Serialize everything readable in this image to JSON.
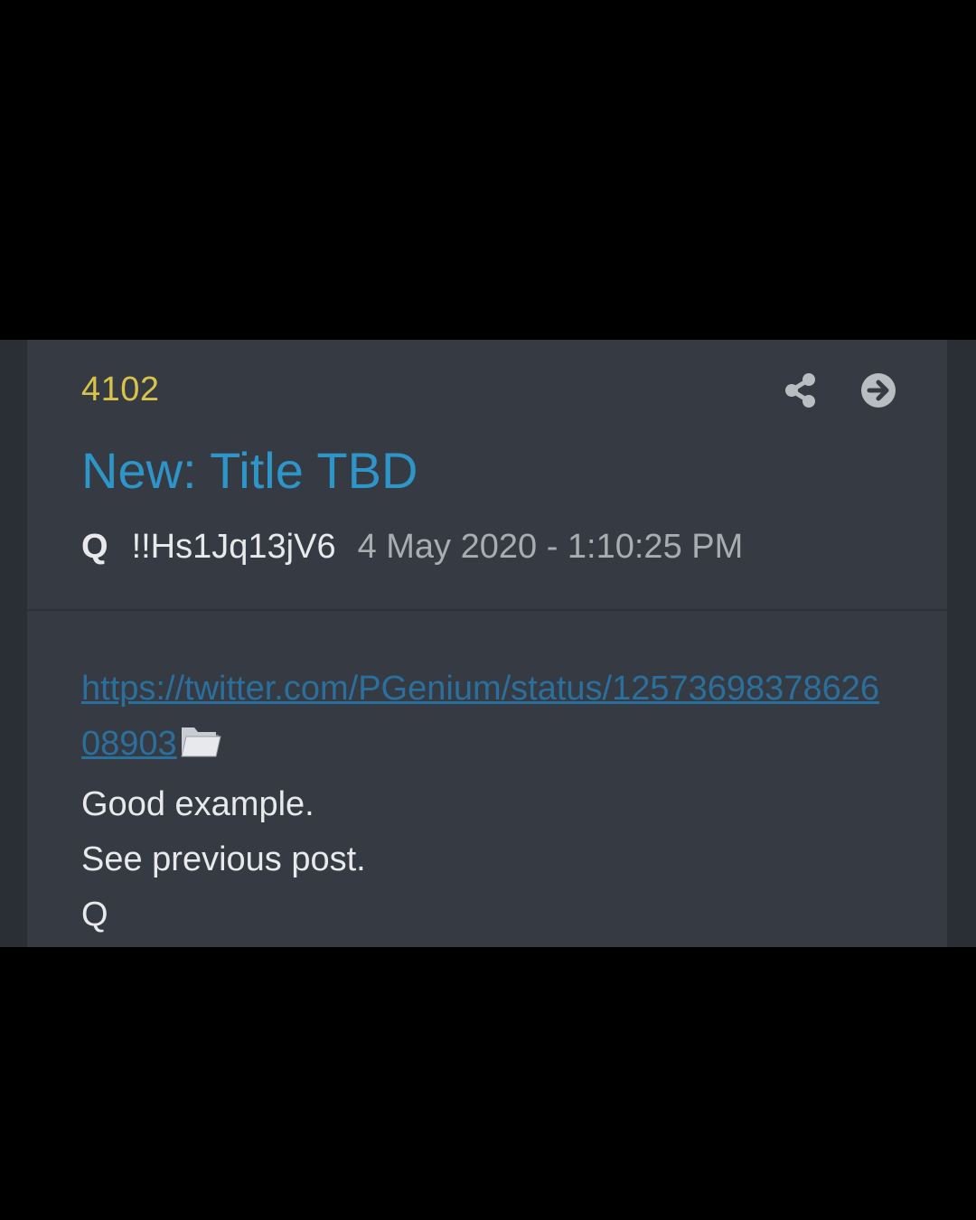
{
  "post": {
    "number": "4102",
    "title": "New: Title TBD",
    "author": "Q",
    "tripcode": "!!Hs1Jq13jV6",
    "timestamp": "4 May 2020 - 1:10:25 PM",
    "link": "https://twitter.com/PGenium/status/1257369837862608903",
    "lines": [
      "Good example.",
      "See previous post.",
      "Q"
    ]
  },
  "icons": {
    "share": "share-icon",
    "go": "arrow-right-circle-icon",
    "attachment": "folder-icon"
  },
  "colors": {
    "number": "#d9c24a",
    "title": "#2e95c9",
    "link": "#2b6f9c",
    "card_bg": "#353a43",
    "text": "#e8e9eb",
    "muted": "#a9acb1"
  }
}
